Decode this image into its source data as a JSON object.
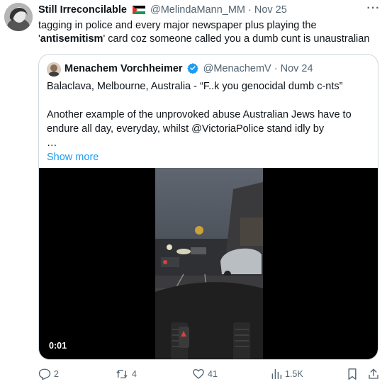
{
  "tweet": {
    "display_name": "Still Irreconcilable",
    "handle_date": "@MelindaMann_MM · Nov 25",
    "text_before": "tagging in police and every major newspaper plus playing the '",
    "text_bold": "antisemitism",
    "text_after": "' card coz someone called you a dumb cunt is unaustralian"
  },
  "quote": {
    "display_name": "Menachem Vorchheimer",
    "handle_date": "@MenachemV · Nov 24",
    "line1": "Balaclava, Melbourne, Australia - “F..k you genocidal dumb c-nts”",
    "line2": "Another example of the unprovoked abuse Australian Jews have to endure all day, everyday, whilst @VictoriaPolice stand idly by",
    "ellipsis": "…",
    "show_more": "Show more",
    "video_time": "0:01"
  },
  "actions": {
    "replies": "2",
    "reposts": "4",
    "likes": "41",
    "views": "1.5K"
  },
  "icons": [
    "more-icon",
    "flag-icon",
    "verified-icon",
    "reply-icon",
    "repost-icon",
    "like-icon",
    "views-icon",
    "bookmark-icon",
    "share-icon"
  ],
  "colors": {
    "link": "#1d9bf0",
    "muted": "#536471",
    "verified": "#1d9bf0"
  }
}
